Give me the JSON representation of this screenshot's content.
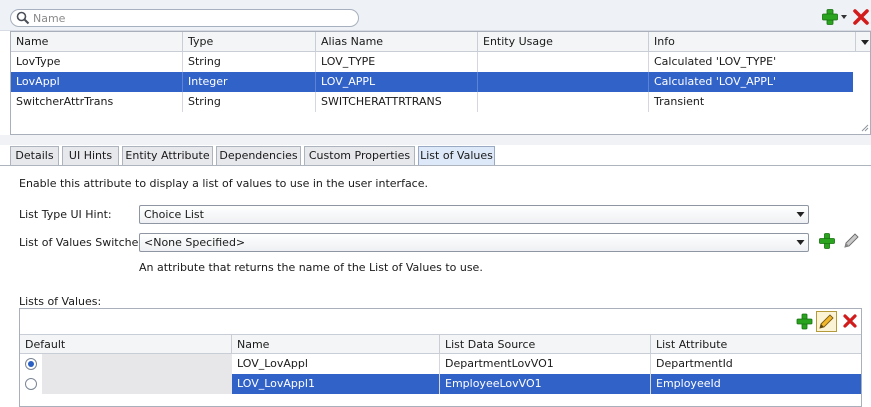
{
  "search": {
    "placeholder": "Name",
    "value": ""
  },
  "colors": {
    "selection": "#3162c8",
    "add_green": "#2aa41f",
    "delete_red": "#d21c1c"
  },
  "attributes": {
    "columns": [
      "Name",
      "Type",
      "Alias Name",
      "Entity Usage",
      "Info"
    ],
    "rows": [
      {
        "name": "LovType",
        "type": "String",
        "alias": "LOV_TYPE",
        "entity_usage": "",
        "info": "Calculated 'LOV_TYPE'"
      },
      {
        "name": "LovAppl",
        "type": "Integer",
        "alias": "LOV_APPL",
        "entity_usage": "",
        "info": "Calculated 'LOV_APPL'"
      },
      {
        "name": "SwitcherAttrTrans",
        "type": "String",
        "alias": "SWITCHERATTRTRANS",
        "entity_usage": "",
        "info": "Transient"
      }
    ],
    "selected_row": 1
  },
  "tabs": [
    {
      "label": "Details"
    },
    {
      "label": "UI Hints"
    },
    {
      "label": "Entity Attribute"
    },
    {
      "label": "Dependencies"
    },
    {
      "label": "Custom Properties"
    },
    {
      "label": "List of Values"
    }
  ],
  "active_tab": 5,
  "lov_form": {
    "description": "Enable this attribute to display a list of values to use in the user interface.",
    "list_type_label": "List Type UI Hint:",
    "list_type_value": "Choice List",
    "switcher_label": "List of Values Switcher:",
    "switcher_value": "<None Specified>",
    "switcher_hint": "An attribute that returns the name of the List of Values to use.",
    "lists_label": "Lists of Values:"
  },
  "lov_table": {
    "columns": [
      "Default",
      "Name",
      "List Data Source",
      "List Attribute"
    ],
    "rows": [
      {
        "is_default": true,
        "name": "LOV_LovAppl",
        "data_source": "DepartmentLovVO1",
        "list_attribute": "DepartmentId"
      },
      {
        "is_default": false,
        "name": "LOV_LovAppl1",
        "data_source": "EmployeeLovVO1",
        "list_attribute": "EmployeeId"
      }
    ],
    "selected_row": 1
  },
  "icons": {
    "search": "search-icon",
    "add": "add-icon",
    "dropdown": "chevron-down-icon",
    "delete": "delete-icon",
    "edit": "pencil-icon",
    "column_menu": "column-menu-icon"
  }
}
